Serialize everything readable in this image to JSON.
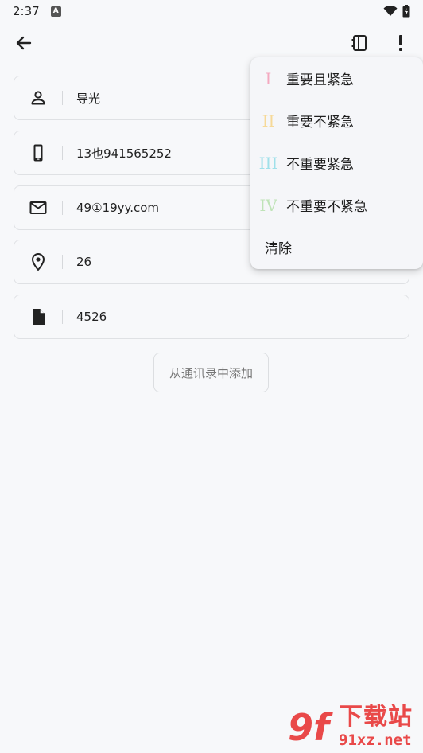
{
  "status_bar": {
    "time": "2:37",
    "badge": "A"
  },
  "contact": {
    "name": "导光",
    "phone": "13也941565252",
    "email": "49①19yy.com",
    "address": "26",
    "note": "4526"
  },
  "add_from_contacts_label": "从通讯录中添加",
  "priority_menu": {
    "items": [
      {
        "numeral": "I",
        "label": "重要且紧急",
        "color": "#f4a9c0"
      },
      {
        "numeral": "II",
        "label": "重要不紧急",
        "color": "#f6d998"
      },
      {
        "numeral": "III",
        "label": "不重要紧急",
        "color": "#9fe0ea"
      },
      {
        "numeral": "IV",
        "label": "不重要不紧急",
        "color": "#bfe3b8"
      }
    ],
    "clear_label": "清除"
  },
  "watermark": {
    "mark": "9f",
    "title": "下载站",
    "url": "91xz.net"
  },
  "colors": {
    "background": "#f7f8fa",
    "border": "#dfe1e4",
    "accent": "#e94949"
  }
}
